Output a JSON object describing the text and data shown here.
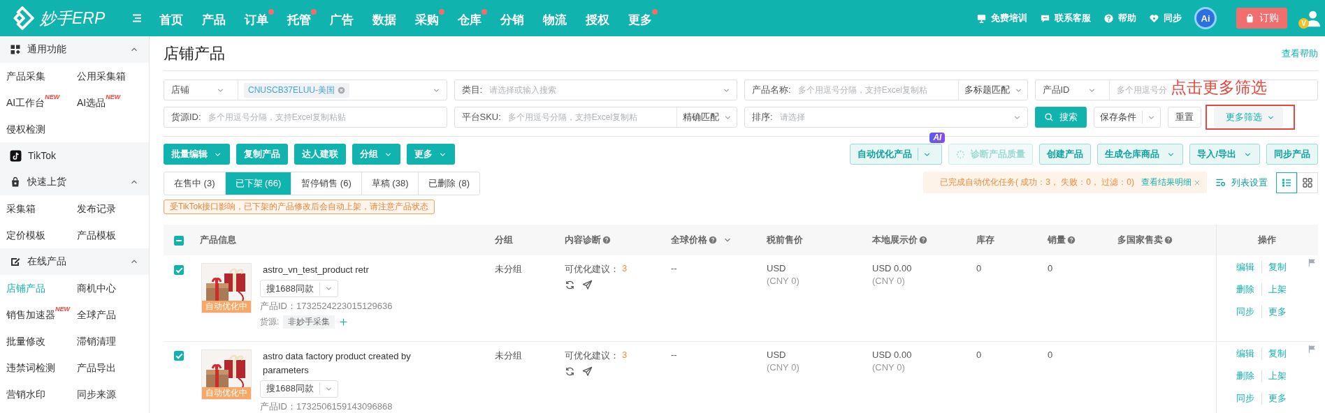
{
  "header": {
    "logo": "妙手ERP",
    "nav": [
      {
        "label": "首页",
        "dot": false
      },
      {
        "label": "产品",
        "dot": false
      },
      {
        "label": "订单",
        "dot": true
      },
      {
        "label": "托管",
        "dot": true
      },
      {
        "label": "广告",
        "dot": false
      },
      {
        "label": "数据",
        "dot": false
      },
      {
        "label": "采购",
        "dot": true
      },
      {
        "label": "仓库",
        "dot": true
      },
      {
        "label": "分销",
        "dot": false
      },
      {
        "label": "物流",
        "dot": false
      },
      {
        "label": "授权",
        "dot": false
      },
      {
        "label": "更多",
        "dot": true
      }
    ],
    "tools": [
      {
        "kind": "training",
        "label": "免费培训"
      },
      {
        "kind": "service",
        "label": "联系客服"
      },
      {
        "kind": "help",
        "label": "帮助"
      },
      {
        "kind": "sync",
        "label": "同步"
      }
    ],
    "ai_label": "Ai",
    "order_button": "订购",
    "avatar_badge": "V"
  },
  "sidebar": [
    {
      "kind": "section",
      "title": "通用功能",
      "expanded": true,
      "items": [
        {
          "label": "产品采集",
          "selected": false
        },
        {
          "label": "公用采集箱",
          "selected": false
        },
        {
          "label": "AI工作台",
          "badge": "NEW",
          "selected": false
        },
        {
          "label": "AI选品",
          "badge": "NEW",
          "selected": false
        },
        {
          "label": "侵权检测",
          "selected": false
        }
      ]
    },
    {
      "kind": "platform",
      "title": "TikTok"
    },
    {
      "kind": "section",
      "title": "快速上货",
      "expanded": true,
      "items": [
        {
          "label": "采集箱",
          "selected": false
        },
        {
          "label": "发布记录",
          "selected": false
        },
        {
          "label": "定价模板",
          "selected": false
        },
        {
          "label": "产品模板",
          "selected": false
        }
      ]
    },
    {
      "kind": "section",
      "title": "在线产品",
      "expanded": true,
      "items": [
        {
          "label": "店铺产品",
          "selected": true
        },
        {
          "label": "商机中心",
          "selected": false
        },
        {
          "label": "销售加速器",
          "badge": "NEW",
          "selected": false
        },
        {
          "label": "全球产品",
          "selected": false
        },
        {
          "label": "批量修改",
          "selected": false
        },
        {
          "label": "滞销清理",
          "selected": false
        },
        {
          "label": "违禁词检测",
          "selected": false
        },
        {
          "label": "产品导出",
          "selected": false
        },
        {
          "label": "营销水印",
          "selected": false
        },
        {
          "label": "同步来源",
          "selected": false
        }
      ]
    }
  ],
  "page": {
    "title": "店铺产品",
    "help_link": "查看帮助"
  },
  "filters": [
    {
      "kind": "select_tags",
      "label": "店铺",
      "tags": [
        "CNUSCB37ELUU-美国"
      ]
    },
    {
      "kind": "select",
      "label": "类目:",
      "placeholder": "请选择或输入搜索"
    },
    {
      "kind": "input_match",
      "label": "产品名称:",
      "placeholder": "多个用逗号分隔，支持Excel复制粘",
      "match": "多标题匹配"
    },
    {
      "kind": "select_input",
      "label": "产品ID",
      "placeholder": "多个用逗号分"
    },
    {
      "kind": "input",
      "label": "货源ID:",
      "placeholder": "多个用逗号分隔，支持Excel复制粘贴"
    },
    {
      "kind": "input_match",
      "label": "平台SKU:",
      "placeholder": "多个用逗号分隔，支持Excel复制粘",
      "match": "精确匹配"
    },
    {
      "kind": "select",
      "label": "排序:",
      "placeholder": "请选择"
    }
  ],
  "filter_actions": [
    {
      "kind": "primary",
      "label": "搜索"
    },
    {
      "kind": "split",
      "label": "保存条件"
    },
    {
      "kind": "plain",
      "label": "重置"
    },
    {
      "kind": "dropdown",
      "label": "更多筛选"
    }
  ],
  "annotation": {
    "text": "点击更多筛选"
  },
  "toolbar_left": [
    {
      "label": "批量编辑",
      "dropdown": true
    },
    {
      "label": "复制产品",
      "dropdown": false
    },
    {
      "label": "达人建联",
      "dropdown": false
    },
    {
      "label": "分组",
      "dropdown": true
    },
    {
      "label": "更多",
      "dropdown": true
    }
  ],
  "toolbar_right": [
    {
      "kind": "split",
      "label": "自动优化产品",
      "badge": "AI",
      "disabled": false
    },
    {
      "kind": "loading",
      "label": "诊断产品质量",
      "disabled": true
    },
    {
      "kind": "plain",
      "label": "创建产品",
      "disabled": false
    },
    {
      "kind": "dropdown",
      "label": "生成仓库商品",
      "disabled": false
    },
    {
      "kind": "dropdown",
      "label": "导入/导出",
      "disabled": false
    },
    {
      "kind": "plain",
      "label": "同步产品",
      "disabled": false
    }
  ],
  "tabs": [
    {
      "label": "在售中 (3)",
      "selected": false
    },
    {
      "label": "已下架 (66)",
      "selected": true
    },
    {
      "label": "暂停销售 (6)",
      "selected": false
    },
    {
      "label": "草稿 (38)",
      "selected": false
    },
    {
      "label": "已删除 (8)",
      "selected": false
    }
  ],
  "notice": "受TikTok接口影响，已下架的产品修改后会自动上架，请注意产品状态",
  "task_banner": {
    "text": "已完成自动优化任务( 成功：3， 失败：0， 过滤：0)",
    "link": "查看结果明细"
  },
  "list_settings": "列表设置",
  "views": [
    {
      "kind": "list",
      "selected": true
    },
    {
      "kind": "grid",
      "selected": false
    }
  ],
  "table": {
    "indeterminate": true,
    "columns": [
      {
        "label": "产品信息",
        "help": false,
        "sort": false
      },
      {
        "label": "分组",
        "help": false,
        "sort": false
      },
      {
        "label": "内容诊断",
        "help": true,
        "sort": false
      },
      {
        "label": "全球价格",
        "help": true,
        "sort": true
      },
      {
        "label": "税前售价",
        "help": false,
        "sort": false
      },
      {
        "label": "本地展示价",
        "help": true,
        "sort": false
      },
      {
        "label": "库存",
        "help": false,
        "sort": false
      },
      {
        "label": "销量",
        "help": true,
        "sort": false
      },
      {
        "label": "多国家售卖",
        "help": true,
        "sort": false
      },
      {
        "label": "操作",
        "help": false,
        "sort": false
      }
    ],
    "rows": [
      {
        "checked": true,
        "title": "astro_vn_test_product retr",
        "status": "自动优化中",
        "similar": "搜1688同款",
        "product_id": "产品ID：1732524223015129636",
        "source_label": "货源:",
        "source": "非妙手采集",
        "group": "未分组",
        "diagnosis": "可优化建议：",
        "suggestions": "3",
        "global_price": "--",
        "pretax": "USD",
        "pretax_cny": "(CNY 0)",
        "local": "USD 0.00",
        "local_cny": "(CNY 0)",
        "stock": "0",
        "sales": "0",
        "actions": [
          "编辑",
          "复制",
          "删除",
          "上架",
          "同步",
          "更多"
        ]
      },
      {
        "checked": true,
        "title": "astro data factory product created by parameters",
        "status": "自动优化中",
        "similar": "搜1688同款",
        "product_id": "产品ID：1732506159143096868",
        "group": "未分组",
        "diagnosis": "可优化建议：",
        "suggestions": "3",
        "global_price": "--",
        "pretax": "USD",
        "pretax_cny": "(CNY 0)",
        "local": "USD 0.00",
        "local_cny": "(CNY 0)",
        "stock": "0",
        "sales": "0",
        "actions": [
          "编辑",
          "复制",
          "删除",
          "上架",
          "同步",
          "更多"
        ]
      }
    ]
  }
}
